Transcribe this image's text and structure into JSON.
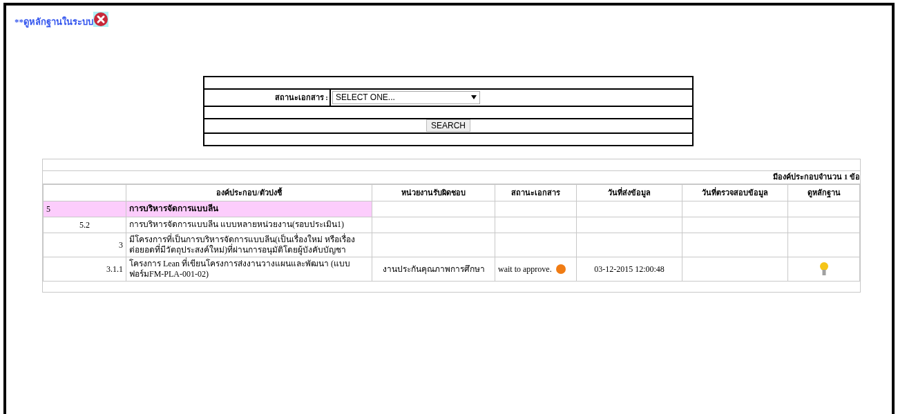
{
  "link": {
    "text": "**ดูหลักฐานในระบบ"
  },
  "search_form": {
    "label": "สถานะเอกสาร :",
    "select_value": "SELECT ONE...",
    "button": "SEARCH"
  },
  "table": {
    "summary": "มีองค์ประกอบจำนวน 1 ข้อ",
    "columns": [
      "",
      "องค์ประกอบ/ตัวบ่งชี้",
      "หน่วยงานรับผิดชอบ",
      "สถานะเอกสาร",
      "วันที่ส่งข้อมูล",
      "วันที่ตรวจสอบข้อมูล",
      "ดูหลักฐาน"
    ],
    "rows": [
      {
        "kind": "group",
        "code": "5",
        "title": "การบริหารจัดการแบบลีน"
      },
      {
        "kind": "sub",
        "code": "5.2",
        "title": "การบริหารจัดการแบบลีน แบบหลายหน่วยงาน(รอบประเมิน1)"
      },
      {
        "kind": "item",
        "code": "3",
        "title": "มีโครงการที่เป็นการบริหารจัดการแบบลีน(เป็นเรื่องใหม่ หรือเรื่องต่อยอดที่มีวัตถุประสงค์ใหม่)ที่ผ่านการอนุมัติโดยผู้บังคับบัญชา"
      },
      {
        "kind": "item",
        "code": "3.1.1",
        "title": "โครงการ Lean ที่เขียนโครงการส่งงานวางแผนและพัฒนา (แบบฟอร์มFM-PLA-001-02)",
        "unit": "งานประกันคุณภาพการศึกษา",
        "status": "wait to approve.",
        "color": "#f07c14",
        "sent_date": "03-12-2015 12:00:48",
        "has_evidence": true
      }
    ]
  }
}
